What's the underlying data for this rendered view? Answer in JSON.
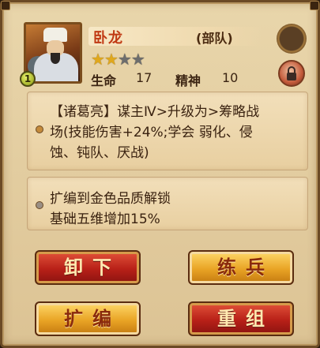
{
  "hero": {
    "name": "卧龙",
    "unit_type": "(部队)",
    "level": "1",
    "stars_filled": 2,
    "stars_total": 4,
    "stats": [
      {
        "label": "生命",
        "value": "17"
      },
      {
        "label": "精神",
        "value": "10"
      }
    ]
  },
  "skill_box": {
    "lines": [
      "【诸葛亮】谋主Ⅳ>升级为>筹略战",
      "场(技能伤害+24%;学会 弱化、侵",
      "蚀、钝队、厌战)"
    ]
  },
  "upgrade_box": {
    "lines": [
      "扩编到金色品质解锁",
      "基础五维增加15%"
    ]
  },
  "buttons": {
    "unequip": "卸下",
    "train": "练兵",
    "expand": "扩编",
    "reorganize": "重组"
  },
  "colors": {
    "accent_red": "#c03a14",
    "button_red": "#b82018",
    "button_gold": "#e9a425",
    "panel_bg": "#e9d6ab"
  },
  "icons": [
    "lock-icon",
    "equipment-slot-icon",
    "star-icon",
    "level-badge-icon"
  ]
}
